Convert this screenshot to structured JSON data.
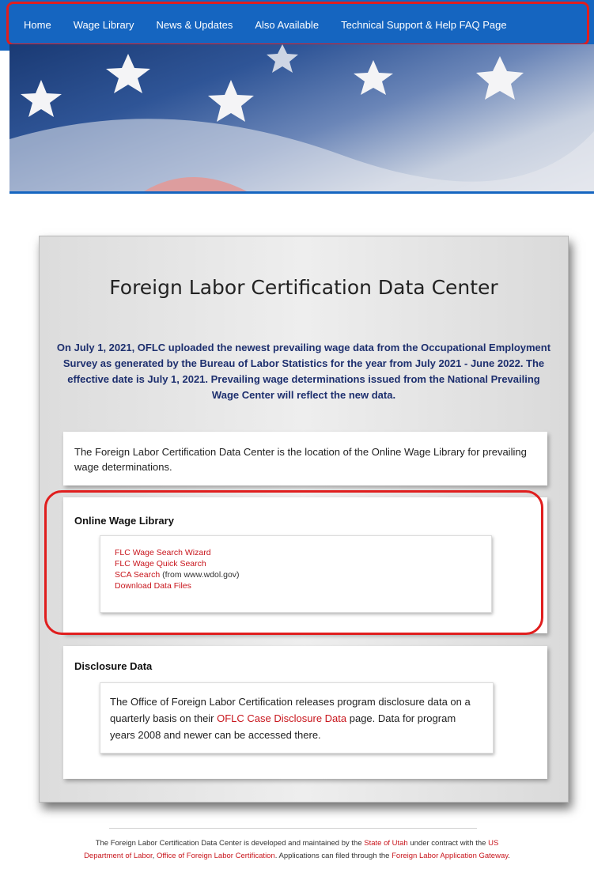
{
  "nav": {
    "items": [
      {
        "label": "Home"
      },
      {
        "label": "Wage Library"
      },
      {
        "label": "News & Updates"
      },
      {
        "label": "Also Available"
      },
      {
        "label": "Technical Support & Help FAQ Page"
      }
    ]
  },
  "banner": {
    "image": "american-flag-banner"
  },
  "main": {
    "title": "Foreign Labor Certification Data Center",
    "notice": "On July 1, 2021, OFLC uploaded the newest prevailing wage data from the Occupational Employment Survey as generated by the Bureau of Labor Statistics for the year from July 2021 - June 2022. The effective date is July 1, 2021. Prevailing wage determinations issued from the National Prevailing Wage Center will reflect the new data.",
    "intro": "The Foreign Labor Certification Data Center is the location of the Online Wage Library for prevailing wage determinations.",
    "online_wage_library": {
      "heading": "Online Wage Library",
      "links": {
        "wizard": "FLC Wage Search Wizard",
        "quick": "FLC Wage Quick Search",
        "sca": "SCA Search",
        "sca_suffix": " (from www.wdol.gov)",
        "download": "Download Data Files"
      }
    },
    "disclosure": {
      "heading": "Disclosure Data",
      "text_before": "The Office of Foreign Labor Certification releases program disclosure data on a quarterly basis on their ",
      "link": "OFLC Case Disclosure Data",
      "text_after": " page. Data for program years 2008 and newer can be accessed there."
    }
  },
  "footer": {
    "t1": "The Foreign Labor Certification Data Center is developed and maintained by the ",
    "link_utah": "State of Utah",
    "t2": " under contract with the ",
    "link_usdol": "US Department of Labor",
    "t3": ", ",
    "link_oflc": "Office of Foreign Labor Certification",
    "t4": ". Applications can filed through the ",
    "link_gateway": "Foreign Labor Application Gateway",
    "t5": "."
  },
  "colors": {
    "nav_bg": "#1565c0",
    "link": "#c8161d",
    "notice_text": "#1d2f6e",
    "highlight": "#e01e1e"
  }
}
